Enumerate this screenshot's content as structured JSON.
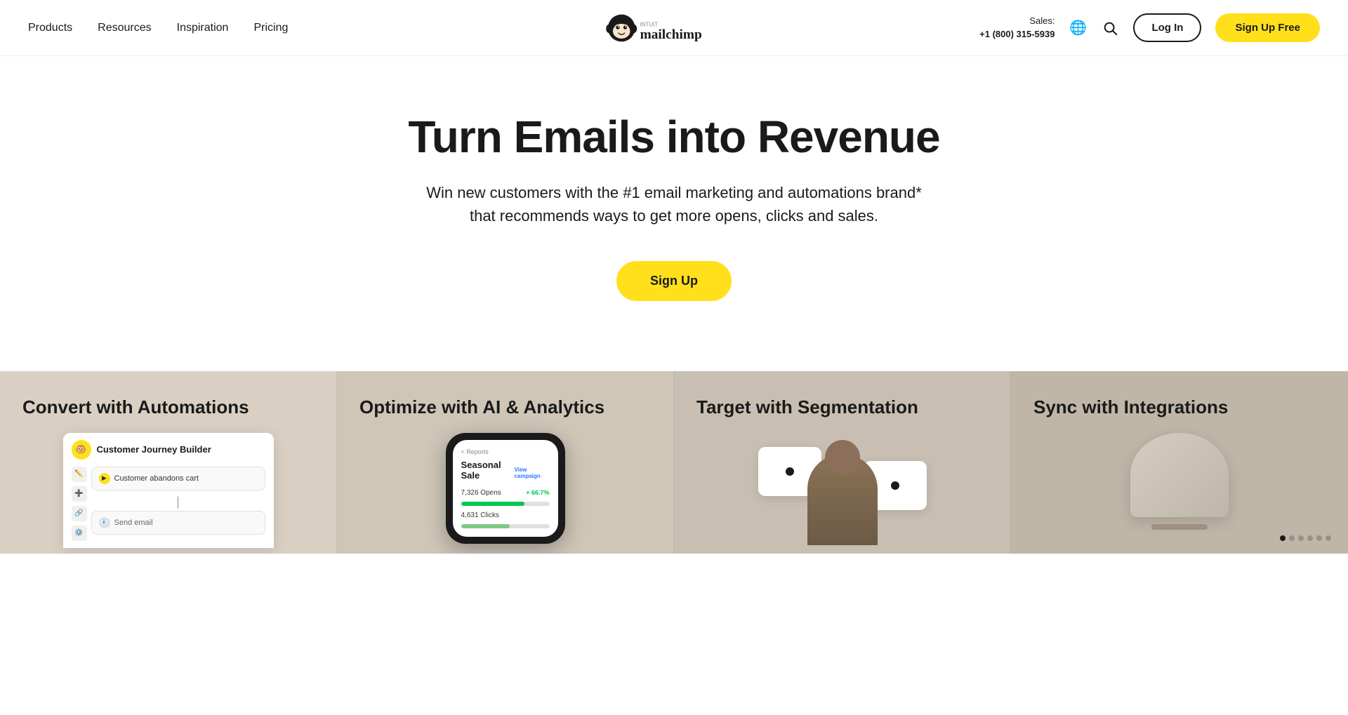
{
  "nav": {
    "items": [
      {
        "label": "Products",
        "id": "products"
      },
      {
        "label": "Resources",
        "id": "resources"
      },
      {
        "label": "Inspiration",
        "id": "inspiration"
      },
      {
        "label": "Pricing",
        "id": "pricing"
      }
    ],
    "logo_alt": "Intuit Mailchimp",
    "sales_label": "Sales:",
    "sales_phone": "+1 (800) 315-5939",
    "login_label": "Log In",
    "signup_label": "Sign Up Free"
  },
  "hero": {
    "headline": "Turn Emails into Revenue",
    "subheadline": "Win new customers with the #1 email marketing and automations brand* that recommends ways to get more opens, clicks and sales.",
    "cta_label": "Sign Up"
  },
  "features": [
    {
      "id": "automations",
      "title": "Convert with Automations",
      "mockup_title": "Customer Journey Builder",
      "node_label": "Customer abandons cart"
    },
    {
      "id": "ai-analytics",
      "title": "Optimize with AI & Analytics",
      "campaign_label": "Seasonal Sale",
      "opens_label": "7,326 Opens",
      "clicks_label": "4,631 Clicks",
      "percent_label": "+ 66.7%",
      "reports_label": "< Reports",
      "view_campaign_label": "View campaign"
    },
    {
      "id": "segmentation",
      "title": "Target with Segmentation"
    },
    {
      "id": "integrations",
      "title": "Sync with Integrations"
    }
  ],
  "dots": [
    {
      "active": true
    },
    {
      "active": false
    },
    {
      "active": false
    },
    {
      "active": false
    },
    {
      "active": false
    },
    {
      "active": false
    }
  ]
}
